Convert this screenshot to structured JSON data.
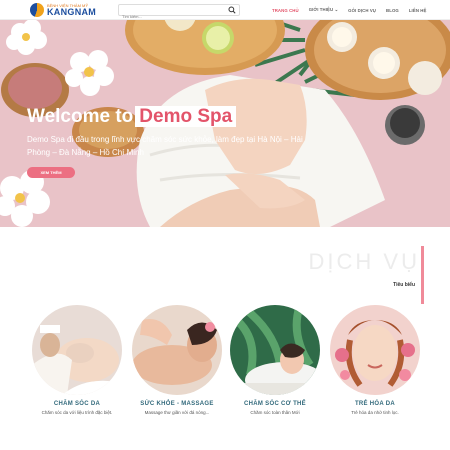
{
  "header": {
    "logo_top": "BỆNH VIỆN THẨM MỸ",
    "logo_main": "KANGNAM",
    "search_placeholder": "Tìm kiếm...",
    "nav": [
      {
        "label": "TRANG CHỦ"
      },
      {
        "label": "GIỚI THIỆU ⌄"
      },
      {
        "label": "GÓI DỊCH VỤ"
      },
      {
        "label": "BLOG"
      },
      {
        "label": "LIÊN HỆ"
      }
    ]
  },
  "hero": {
    "title": "Welcome to",
    "title_highlight": "Demo Spa",
    "description": "Demo Spa đi đầu trong lĩnh vực chăm sóc sức khỏe, làm đẹp tại Hà Nội – Hải Phòng – Đà Nẵng – Hồ Chí Minh",
    "button_label": "XEM THÊM",
    "slide_count": 3,
    "active_slide": 1
  },
  "services": {
    "title": "DỊCH VỤ",
    "subtitle": "Tiêu biểu",
    "items": [
      {
        "name": "CHĂM SÓC DA",
        "desc": "Chăm sóc da với liệu trình đặc biệt."
      },
      {
        "name": "SỨC KHỎE - MASSAGE",
        "desc": "Massage thư giãn với đá nóng..."
      },
      {
        "name": "CHĂM SÓC CƠ THỂ",
        "desc": "Chăm sóc toàn thân Mới"
      },
      {
        "name": "TRẺ HÓA DA",
        "desc": "Trẻ hóa da nhờ tinh lọc."
      }
    ]
  },
  "colors": {
    "accent": "#e3546a",
    "service_title": "#336a7c",
    "hero_bg": "#e9c3c8"
  }
}
